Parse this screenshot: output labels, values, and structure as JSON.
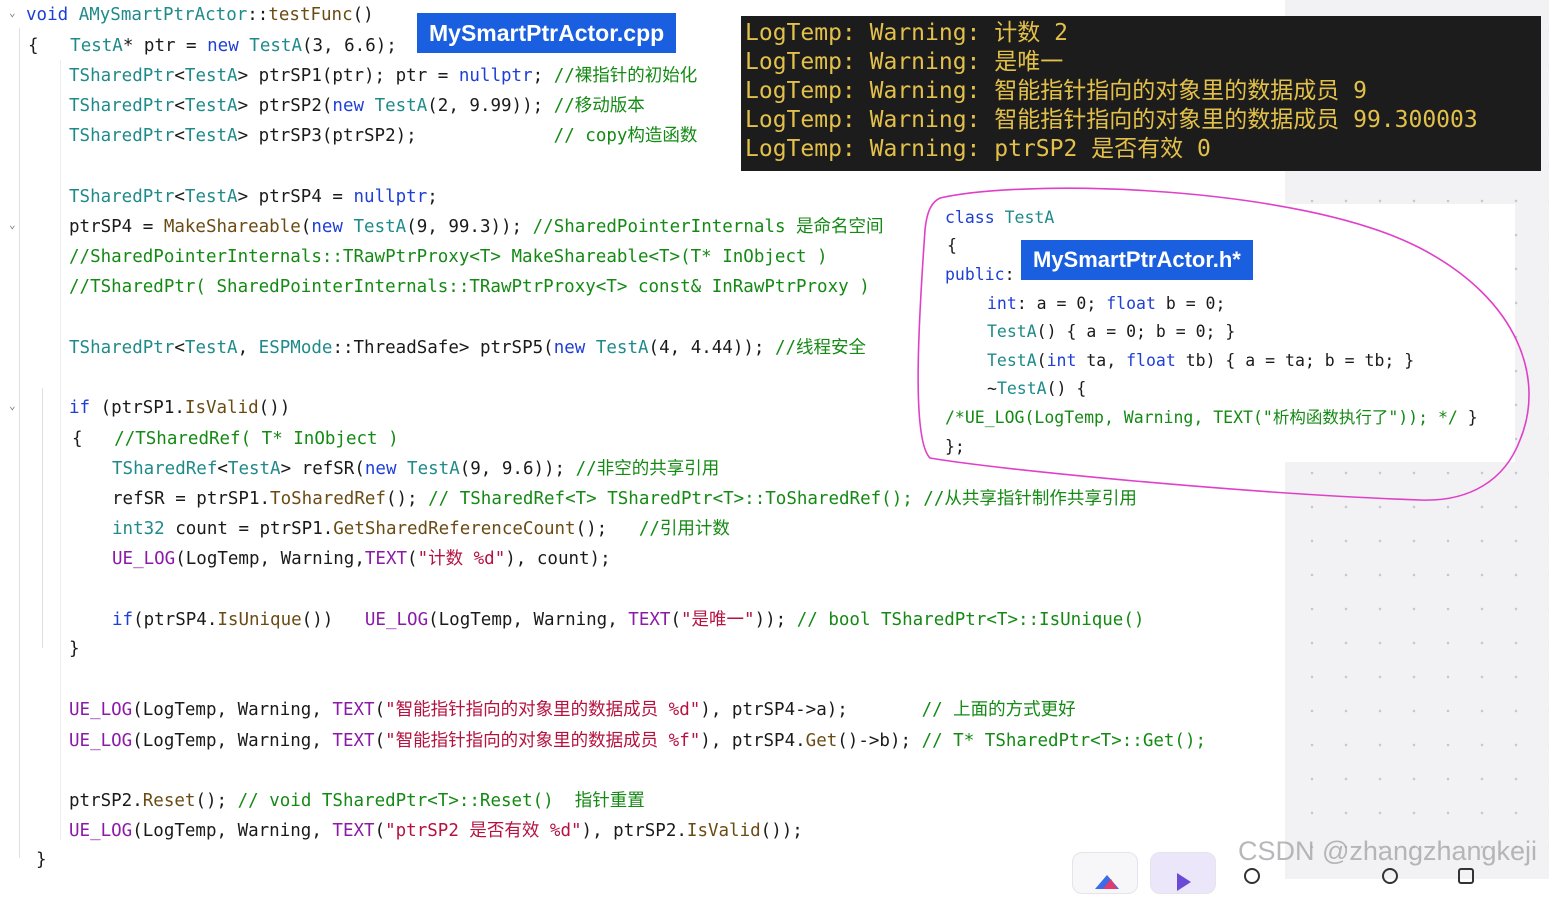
{
  "editor": {
    "lines": [
      [
        [
          "kw",
          "void "
        ],
        [
          "ty",
          "AMySmartPtrActor"
        ],
        [
          "",
          "::"
        ],
        [
          "fn",
          "testFunc"
        ],
        [
          "",
          "()"
        ]
      ],
      [
        [
          "",
          "{   "
        ],
        [
          "ty",
          "TestA"
        ],
        [
          "",
          "* ptr = "
        ],
        [
          "kw",
          "new "
        ],
        [
          "ty",
          "TestA"
        ],
        [
          "",
          "(3, 6.6);"
        ]
      ],
      [
        [
          "ty",
          "TSharedPtr"
        ],
        [
          "",
          "<"
        ],
        [
          "ty",
          "TestA"
        ],
        [
          "",
          "> ptrSP1(ptr); ptr = "
        ],
        [
          "kw",
          "nullptr"
        ],
        [
          "",
          "; "
        ],
        [
          "cm",
          "//裸指针的初始化"
        ]
      ],
      [
        [
          "ty",
          "TSharedPtr"
        ],
        [
          "",
          "<"
        ],
        [
          "ty",
          "TestA"
        ],
        [
          "",
          "> ptrSP2("
        ],
        [
          "kw",
          "new "
        ],
        [
          "ty",
          "TestA"
        ],
        [
          "",
          "(2, 9.99)); "
        ],
        [
          "cm",
          "//移动版本"
        ]
      ],
      [
        [
          "ty",
          "TSharedPtr"
        ],
        [
          "",
          "<"
        ],
        [
          "ty",
          "TestA"
        ],
        [
          "",
          "> ptrSP3(ptrSP2);             "
        ],
        [
          "cm",
          "// copy构造函数"
        ]
      ],
      [
        [
          "ty",
          "TSharedPtr"
        ],
        [
          "",
          "<"
        ],
        [
          "ty",
          "TestA"
        ],
        [
          "",
          "> ptrSP4 = "
        ],
        [
          "kw",
          "nullptr"
        ],
        [
          "",
          ";"
        ]
      ],
      [
        [
          "",
          "ptrSP4 = "
        ],
        [
          "fn",
          "MakeShareable"
        ],
        [
          "",
          "("
        ],
        [
          "kw",
          "new "
        ],
        [
          "ty",
          "TestA"
        ],
        [
          "",
          "(9, 99.3)); "
        ],
        [
          "cm",
          "//SharedPointerInternals 是命名空间"
        ]
      ],
      [
        [
          "cm",
          "//SharedPointerInternals::TRawPtrProxy<T> MakeShareable<T>(T* InObject )"
        ]
      ],
      [
        [
          "cm",
          "//TSharedPtr( SharedPointerInternals::TRawPtrProxy<T> const& InRawPtrProxy )"
        ]
      ],
      [
        [
          "ty",
          "TSharedPtr"
        ],
        [
          "",
          "<"
        ],
        [
          "ty",
          "TestA"
        ],
        [
          "",
          ", "
        ],
        [
          "ty",
          "ESPMode"
        ],
        [
          "",
          "::ThreadSafe> ptrSP5("
        ],
        [
          "kw",
          "new "
        ],
        [
          "ty",
          "TestA"
        ],
        [
          "",
          "(4, 4.44)); "
        ],
        [
          "cm",
          "//线程安全"
        ]
      ],
      [
        [
          "kw",
          "if "
        ],
        [
          "",
          "(ptrSP1."
        ],
        [
          "fn",
          "IsValid"
        ],
        [
          "",
          "())"
        ]
      ],
      [
        [
          "",
          "{   "
        ],
        [
          "cm",
          "//TSharedRef( T* InObject )"
        ]
      ],
      [
        [
          "ty",
          "TSharedRef"
        ],
        [
          "",
          "<"
        ],
        [
          "ty",
          "TestA"
        ],
        [
          "",
          "> refSR("
        ],
        [
          "kw",
          "new "
        ],
        [
          "ty",
          "TestA"
        ],
        [
          "",
          "(9, 9.6)); "
        ],
        [
          "cm",
          "//非空的共享引用"
        ]
      ],
      [
        [
          "",
          "refSR = ptrSP1."
        ],
        [
          "fn",
          "ToSharedRef"
        ],
        [
          "",
          "(); "
        ],
        [
          "cm",
          "// TSharedRef<T> TSharedPtr<T>::ToSharedRef(); //从共享指针制作共享引用"
        ]
      ],
      [
        [
          "ty",
          "int32"
        ],
        [
          "",
          " count = ptrSP1."
        ],
        [
          "fn",
          "GetSharedReferenceCount"
        ],
        [
          "",
          "();   "
        ],
        [
          "cm",
          "//引用计数"
        ]
      ],
      [
        [
          "mac",
          "UE_LOG"
        ],
        [
          "",
          "(LogTemp, Warning,"
        ],
        [
          "mac",
          "TEXT"
        ],
        [
          "",
          "("
        ],
        [
          "st",
          "\"计数 %d\""
        ],
        [
          "",
          "), count);"
        ]
      ],
      [
        [
          "kw",
          "if"
        ],
        [
          "",
          "(ptrSP4."
        ],
        [
          "fn",
          "IsUnique"
        ],
        [
          "",
          "())   "
        ],
        [
          "mac",
          "UE_LOG"
        ],
        [
          "",
          "(LogTemp, Warning, "
        ],
        [
          "mac",
          "TEXT"
        ],
        [
          "",
          "("
        ],
        [
          "st",
          "\"是唯一\""
        ],
        [
          "",
          ")); "
        ],
        [
          "cm",
          "// bool TSharedPtr<T>::IsUnique()"
        ]
      ],
      [
        [
          "",
          "}"
        ]
      ],
      [
        [
          "mac",
          "UE_LOG"
        ],
        [
          "",
          "(LogTemp, Warning, "
        ],
        [
          "mac",
          "TEXT"
        ],
        [
          "",
          "("
        ],
        [
          "st",
          "\"智能指针指向的对象里的数据成员 %d\""
        ],
        [
          "",
          "), ptrSP4->a);       "
        ],
        [
          "cm",
          "// 上面的方式更好"
        ]
      ],
      [
        [
          "mac",
          "UE_LOG"
        ],
        [
          "",
          "(LogTemp, Warning, "
        ],
        [
          "mac",
          "TEXT"
        ],
        [
          "",
          "("
        ],
        [
          "st",
          "\"智能指针指向的对象里的数据成员 %f\""
        ],
        [
          "",
          "), ptrSP4."
        ],
        [
          "fn",
          "Get"
        ],
        [
          "",
          "()->b); "
        ],
        [
          "cm",
          "// T* TSharedPtr<T>::Get();"
        ]
      ],
      [
        [
          "",
          "ptrSP2."
        ],
        [
          "fn",
          "Reset"
        ],
        [
          "",
          "(); "
        ],
        [
          "cm",
          "// void TSharedPtr<T>::Reset()  指针重置"
        ]
      ],
      [
        [
          "mac",
          "UE_LOG"
        ],
        [
          "",
          "(LogTemp, Warning, "
        ],
        [
          "mac",
          "TEXT"
        ],
        [
          "",
          "("
        ],
        [
          "st",
          "\"ptrSP2 是否有效 %d\""
        ],
        [
          "",
          "), ptrSP2."
        ],
        [
          "fn",
          "IsValid"
        ],
        [
          "",
          "());"
        ]
      ],
      [
        [
          "",
          "}"
        ]
      ]
    ]
  },
  "badges": {
    "cpp_file": "MySmartPtrActor.cpp",
    "header_file": "MySmartPtrActor.h*"
  },
  "output_log": {
    "lines": [
      "LogTemp: Warning: 计数 2",
      "LogTemp: Warning: 是唯一",
      "LogTemp: Warning: 智能指针指向的对象里的数据成员 9",
      "LogTemp: Warning: 智能指针指向的对象里的数据成员 99.300003",
      "LogTemp: Warning: ptrSP2 是否有效 0"
    ]
  },
  "header_code": {
    "lines": [
      [
        [
          "kw",
          "class "
        ],
        [
          "ty",
          "TestA"
        ]
      ],
      [
        [
          "",
          "{"
        ]
      ],
      [
        [
          "kw",
          "public"
        ],
        [
          "",
          ":"
        ]
      ],
      [
        [
          "kw",
          "int"
        ],
        [
          "",
          ": a = 0; "
        ],
        [
          "kw",
          "float"
        ],
        [
          "",
          " b = 0;"
        ]
      ],
      [
        [
          "ty",
          "TestA"
        ],
        [
          "",
          "() { a = 0; b = 0; }"
        ]
      ],
      [
        [
          "ty",
          "TestA"
        ],
        [
          "",
          "("
        ],
        [
          "kw",
          "int"
        ],
        [
          "",
          " ta, "
        ],
        [
          "kw",
          "float"
        ],
        [
          "",
          " tb) { a = ta; b = tb; }"
        ]
      ],
      [
        [
          "",
          "~"
        ],
        [
          "ty",
          "TestA"
        ],
        [
          "",
          "() {"
        ]
      ],
      [
        [
          "cm",
          "/*UE_LOG(LogTemp, Warning, TEXT(\"析构函数执行了\")); */"
        ],
        [
          "",
          " }"
        ]
      ],
      [
        [
          "",
          "};"
        ]
      ]
    ]
  },
  "watermark": "CSDN @zhangzhangkeji",
  "colors": {
    "keyword": "#1e3fd6",
    "type": "#1f8a8a",
    "comment": "#148a14",
    "string": "#b5123f",
    "macro": "#8b1aa8",
    "log_text": "#e2c04a",
    "badge": "#1a5fe0",
    "annotation": "#e040c8"
  }
}
